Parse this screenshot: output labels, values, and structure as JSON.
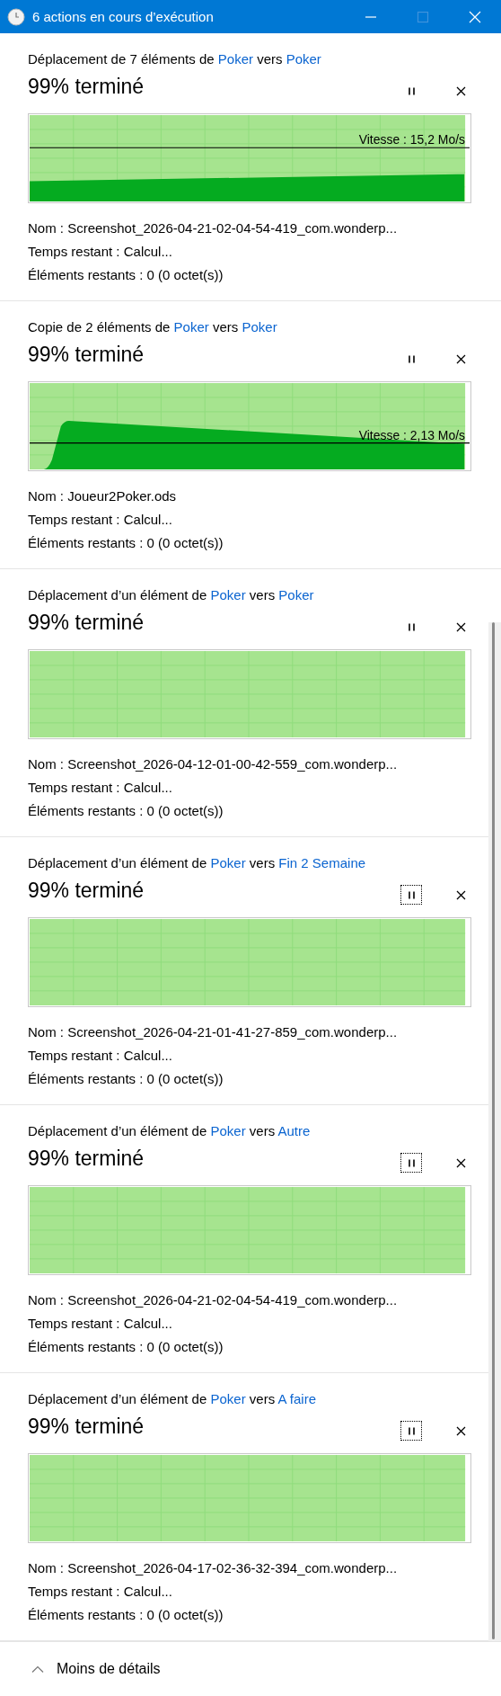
{
  "window": {
    "title": "6 actions en cours d’exécution",
    "maximize_disabled": true
  },
  "operations": [
    {
      "heading": {
        "prefix": "Déplacement de 7 éléments de ",
        "source": "Poker",
        "middle": " vers ",
        "destination": "Poker"
      },
      "percent": "99% terminé",
      "pause_focused": false,
      "graph": {
        "kind": "ramp",
        "level": 0.99,
        "speed": "Vitesse : 15,2 Mo/s"
      },
      "name": "Nom : Screenshot_2026-04-21-02-04-54-419_com.wonderp...",
      "time_left": "Temps restant : Calcul...",
      "items_left": "Éléments restants : 0 (0 octet(s))"
    },
    {
      "heading": {
        "prefix": "Copie de 2 éléments de ",
        "source": "Poker",
        "middle": " vers ",
        "destination": "Poker"
      },
      "percent": "99% terminé",
      "pause_focused": false,
      "graph": {
        "kind": "spike",
        "level": 0.99,
        "speed": "Vitesse : 2,13 Mo/s"
      },
      "name": "Nom : Joueur2Poker.ods",
      "time_left": "Temps restant : Calcul...",
      "items_left": "Éléments restants : 0 (0 octet(s))"
    },
    {
      "heading": {
        "prefix": "Déplacement d’un élément de ",
        "source": "Poker",
        "middle": " vers ",
        "destination": "Poker"
      },
      "percent": "99% terminé",
      "pause_focused": false,
      "graph": {
        "kind": "empty",
        "level": 0.99
      },
      "name": "Nom : Screenshot_2026-04-12-01-00-42-559_com.wonderp...",
      "time_left": "Temps restant : Calcul...",
      "items_left": "Éléments restants : 0 (0 octet(s))"
    },
    {
      "heading": {
        "prefix": "Déplacement d’un élément de ",
        "source": "Poker",
        "middle": " vers ",
        "destination": "Fin 2 Semaine"
      },
      "percent": "99% terminé",
      "pause_focused": true,
      "graph": {
        "kind": "empty",
        "level": 0.99
      },
      "name": "Nom : Screenshot_2026-04-21-01-41-27-859_com.wonderp...",
      "time_left": "Temps restant : Calcul...",
      "items_left": "Éléments restants : 0 (0 octet(s))"
    },
    {
      "heading": {
        "prefix": "Déplacement d’un élément de ",
        "source": "Poker",
        "middle": " vers ",
        "destination": "Autre"
      },
      "percent": "99% terminé",
      "pause_focused": true,
      "graph": {
        "kind": "empty",
        "level": 0.99
      },
      "name": "Nom : Screenshot_2026-04-21-02-04-54-419_com.wonderp...",
      "time_left": "Temps restant : Calcul...",
      "items_left": "Éléments restants : 0 (0 octet(s))"
    },
    {
      "heading": {
        "prefix": "Déplacement d’un élément de ",
        "source": "Poker",
        "middle": " vers ",
        "destination": "A faire"
      },
      "percent": "99% terminé",
      "pause_focused": true,
      "graph": {
        "kind": "empty",
        "level": 0.99
      },
      "name": "Nom : Screenshot_2026-04-17-02-36-32-394_com.wonderp...",
      "time_left": "Temps restant : Calcul...",
      "items_left": "Éléments restants : 0 (0 octet(s))"
    }
  ],
  "footer": {
    "label": "Moins de détails"
  }
}
